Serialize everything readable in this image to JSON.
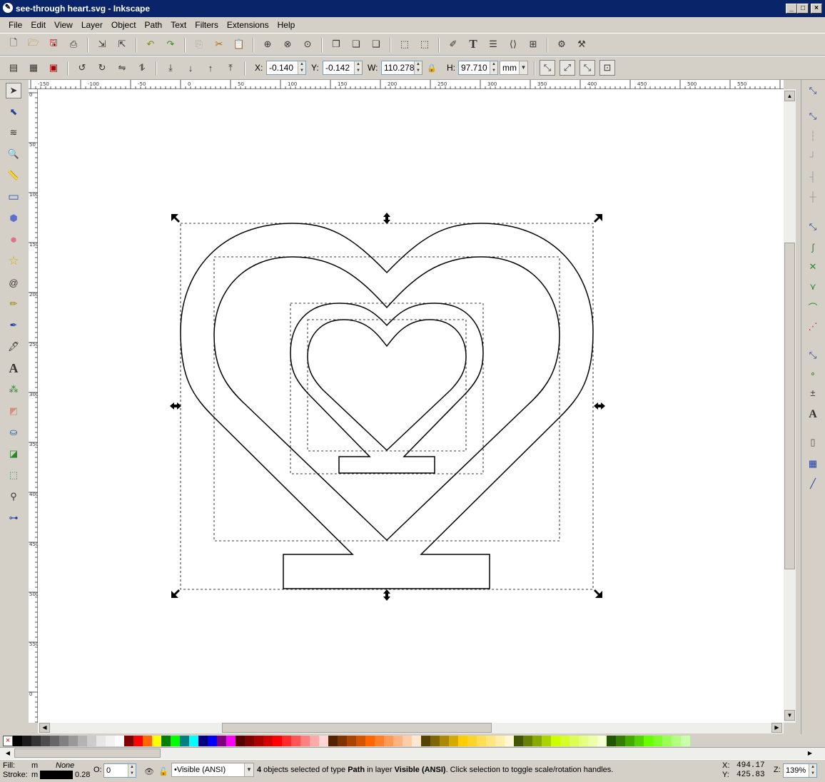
{
  "window": {
    "title": "see-through heart.svg - Inkscape",
    "minimize": "_",
    "maximize": "□",
    "close": "×"
  },
  "menu": [
    "File",
    "Edit",
    "View",
    "Layer",
    "Object",
    "Path",
    "Text",
    "Filters",
    "Extensions",
    "Help"
  ],
  "toolbar": {
    "x_label": "X:",
    "x_value": "-0.140",
    "y_label": "Y:",
    "y_value": "-0.142",
    "w_label": "W:",
    "w_value": "110.278",
    "h_label": "H:",
    "h_value": "97.710",
    "unit": "mm"
  },
  "rulers": {
    "horizontal": [
      "-150",
      "-100",
      "-50",
      "0",
      "50",
      "100",
      "150",
      "200",
      "250",
      "300",
      "350",
      "400",
      "450",
      "500",
      "550",
      "600"
    ],
    "vertical": [
      "0",
      "50",
      "100",
      "150",
      "200",
      "250",
      "300",
      "350",
      "400",
      "450",
      "500",
      "550",
      "0",
      "50",
      "100"
    ]
  },
  "palette": {
    "none_icon": "×",
    "swatches": [
      "#000000",
      "#1a1a1a",
      "#333333",
      "#4d4d4d",
      "#666666",
      "#808080",
      "#999999",
      "#b3b3b3",
      "#cccccc",
      "#e6e6e6",
      "#f2f2f2",
      "#ffffff",
      "#800000",
      "#ff0000",
      "#ff6600",
      "#ffff00",
      "#008000",
      "#00ff00",
      "#008080",
      "#00ffff",
      "#000080",
      "#0000ff",
      "#800080",
      "#ff00ff",
      "#550000",
      "#800000",
      "#aa0000",
      "#d40000",
      "#ff0000",
      "#ff2a2a",
      "#ff5555",
      "#ff8080",
      "#ffaaaa",
      "#ffd5d5",
      "#552200",
      "#803300",
      "#aa4400",
      "#d45500",
      "#ff6600",
      "#ff7f2a",
      "#ff9955",
      "#ffb380",
      "#ffccaa",
      "#ffe6d5",
      "#554400",
      "#806600",
      "#aa8800",
      "#d4aa00",
      "#ffcc00",
      "#ffd42a",
      "#ffdd55",
      "#ffe680",
      "#ffeeaa",
      "#fff6d5",
      "#445500",
      "#668000",
      "#88aa00",
      "#aad400",
      "#ccff00",
      "#d4ff2a",
      "#ddff55",
      "#e5ff80",
      "#eeffaa",
      "#f6ffd5",
      "#225500",
      "#338000",
      "#44aa00",
      "#55d400",
      "#66ff00",
      "#7fff2a",
      "#99ff55",
      "#b3ff80",
      "#ccffaa"
    ]
  },
  "status": {
    "fill_label": "Fill:",
    "fill_value": "m",
    "fill_none": "None",
    "stroke_label": "Stroke:",
    "stroke_value": "m",
    "stroke_width": "0.28",
    "opacity_label": "O:",
    "opacity_value": "0",
    "layer_name": "•Visible (ANSI)",
    "message_count": "4",
    "message_a": " objects selected of type ",
    "message_type": "Path",
    "message_b": " in layer ",
    "message_layer": "Visible (ANSI)",
    "message_c": ". Click selection to toggle scale/rotation handles.",
    "x_label": "X:",
    "x_coord": "494.17",
    "y_label": "Y:",
    "y_coord": "425.83",
    "zoom_label": "Z:",
    "zoom_value": "139%"
  },
  "icons": {
    "toolbox": [
      "selector-arrow-icon",
      "node-editor-icon",
      "tweak-icon",
      "zoom-icon",
      "measure-icon",
      "rectangle-icon",
      "3d-box-icon",
      "ellipse-icon",
      "star-icon",
      "spiral-icon",
      "pencil-icon",
      "pen-icon",
      "calligraphy-icon",
      "text-tool-icon",
      "spray-icon",
      "eraser-icon",
      "paint-bucket-icon",
      "gradient-icon",
      "mesh-icon",
      "dropper-icon",
      "connector-icon"
    ],
    "snap": [
      "snap-toggle-icon",
      "snap-bbox-icon",
      "snap-bbox-edge-icon",
      "snap-bbox-corner-icon",
      "snap-bbox-midpoint-icon",
      "snap-bbox-center-icon",
      "snap-nodes-icon",
      "snap-path-icon",
      "snap-intersection-icon",
      "snap-cusp-icon",
      "snap-smooth-icon",
      "snap-line-midpoint-icon",
      "snap-others-icon",
      "snap-object-center-icon",
      "snap-rotation-center-icon",
      "snap-text-baseline-icon",
      "snap-page-border-icon",
      "snap-grid-icon",
      "snap-guide-icon"
    ]
  }
}
